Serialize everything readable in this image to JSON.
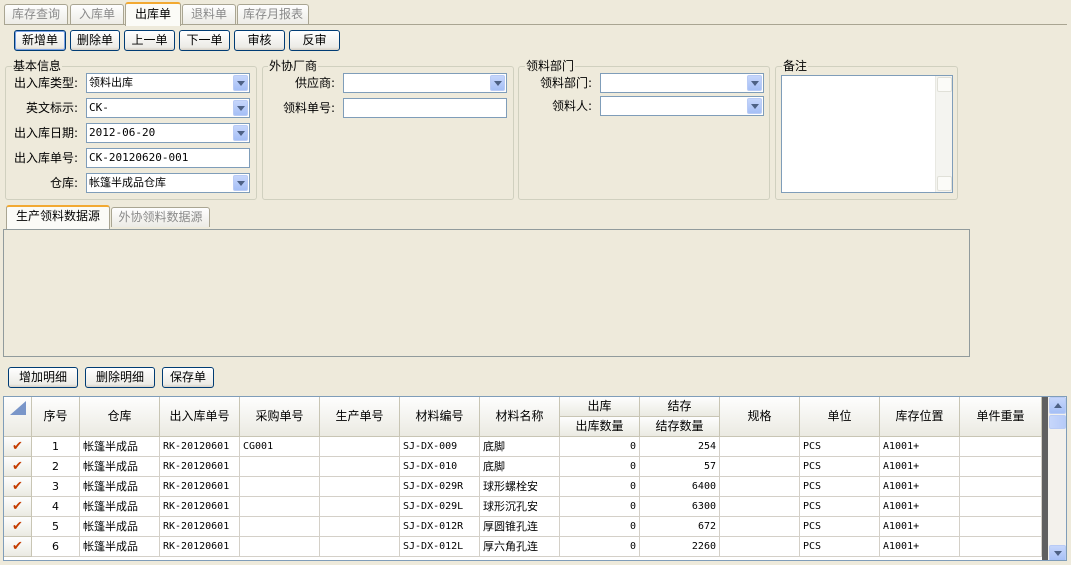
{
  "tabs": [
    "库存查询",
    "入库单",
    "出库单",
    "退料单",
    "库存月报表"
  ],
  "toolbar": [
    "新增单",
    "删除单",
    "上一单",
    "下一单",
    "审核",
    "反审"
  ],
  "basic": {
    "title": "基本信息",
    "type_label": "出入库类型:",
    "type_value": "领料出库",
    "en_label": "英文标示:",
    "en_value": "CK-",
    "date_label": "出入库日期:",
    "date_value": "2012-06-20",
    "no_label": "出入库单号:",
    "no_value": "CK-20120620-001",
    "wh_label": "仓库:",
    "wh_value": "帐篷半成品仓库"
  },
  "supplier": {
    "title": "外协厂商",
    "supplier_label": "供应商:",
    "supplier_value": "",
    "pick_no_label": "领料单号:",
    "pick_no_value": ""
  },
  "dept": {
    "title": "领料部门",
    "dept_label": "领料部门:",
    "dept_value": "",
    "person_label": "领料人:",
    "person_value": ""
  },
  "remark": {
    "title": "备注"
  },
  "source_tabs": [
    "生产领料数据源",
    "外协领料数据源"
  ],
  "detail_buttons": [
    "增加明细",
    "删除明细",
    "保存单"
  ],
  "grid": {
    "headers": [
      "序号",
      "仓库",
      "出入库单号",
      "采购单号",
      "生产单号",
      "材料编号",
      "材料名称",
      "出库",
      "出库数量",
      "结存",
      "结存数量",
      "规格",
      "单位",
      "库存位置",
      "单件重量"
    ],
    "rows": [
      {
        "seq": "1",
        "wh": "帐篷半成品",
        "io_no": "RK-20120601",
        "po": "CG001",
        "mo": "",
        "code": "SJ-DX-009",
        "name": "底脚",
        "out_qty": "0",
        "bal_qty": "254",
        "spec": "",
        "unit": "PCS",
        "loc": "A1001+",
        "wt": ""
      },
      {
        "seq": "2",
        "wh": "帐篷半成品",
        "io_no": "RK-20120601",
        "po": "",
        "mo": "",
        "code": "SJ-DX-010",
        "name": "底脚",
        "out_qty": "0",
        "bal_qty": "57",
        "spec": "",
        "unit": "PCS",
        "loc": "A1001+",
        "wt": ""
      },
      {
        "seq": "3",
        "wh": "帐篷半成品",
        "io_no": "RK-20120601",
        "po": "",
        "mo": "",
        "code": "SJ-DX-029R",
        "name": "球形螺栓安",
        "out_qty": "0",
        "bal_qty": "6400",
        "spec": "",
        "unit": "PCS",
        "loc": "A1001+",
        "wt": ""
      },
      {
        "seq": "4",
        "wh": "帐篷半成品",
        "io_no": "RK-20120601",
        "po": "",
        "mo": "",
        "code": "SJ-DX-029L",
        "name": "球形沉孔安",
        "out_qty": "0",
        "bal_qty": "6300",
        "spec": "",
        "unit": "PCS",
        "loc": "A1001+",
        "wt": ""
      },
      {
        "seq": "5",
        "wh": "帐篷半成品",
        "io_no": "RK-20120601",
        "po": "",
        "mo": "",
        "code": "SJ-DX-012R",
        "name": "厚圆锥孔连",
        "out_qty": "0",
        "bal_qty": "672",
        "spec": "",
        "unit": "PCS",
        "loc": "A1001+",
        "wt": ""
      },
      {
        "seq": "6",
        "wh": "帐篷半成品",
        "io_no": "RK-20120601",
        "po": "",
        "mo": "",
        "code": "SJ-DX-012L",
        "name": "厚六角孔连",
        "out_qty": "0",
        "bal_qty": "2260",
        "spec": "",
        "unit": "PCS",
        "loc": "A1001+",
        "wt": ""
      }
    ]
  }
}
